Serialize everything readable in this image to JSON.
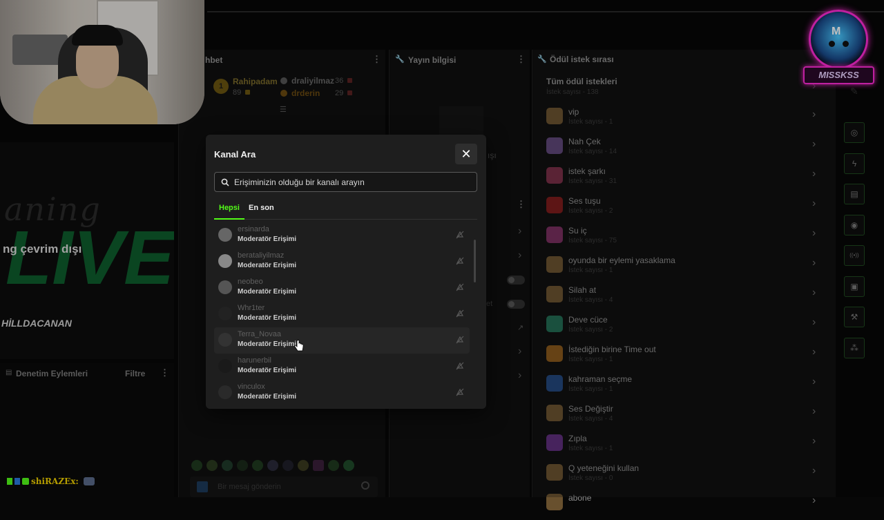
{
  "panels": {
    "chat_title_partial": "hbet",
    "stream_info_title": "Yayın bilgisi",
    "rewards_title": "Ödül istek sırası",
    "mod_actions_title": "Denetim Eylemleri",
    "mod_actions_filter": "Filtre"
  },
  "leaderboard": {
    "first": {
      "rank": "1",
      "name": "Rahipadam",
      "points": "89"
    },
    "second": {
      "name": "draliyilmaz",
      "points": "36"
    },
    "third": {
      "name": "drderin",
      "points": "29"
    }
  },
  "offline_banner": {
    "line1": "aning",
    "line2": "ng çevrim dışı",
    "sign": "HİLLDACANAN"
  },
  "stream_info_partial": "ışı",
  "chat": {
    "input_placeholder": "Bir mesaj gönderin",
    "user_overlay": "shiRAZEx:"
  },
  "modal": {
    "title": "Kanal Ara",
    "close_symbol": "✕",
    "search_placeholder": "Erişiminizin olduğu bir kanalı arayın",
    "tabs": [
      "Hepsi",
      "En son"
    ],
    "active_tab": "Hepsi",
    "channels": [
      {
        "name": "ersinarda",
        "role": "Moderatör Erişimi"
      },
      {
        "name": "berataliyilmaz",
        "role": "Moderatör Erişimi"
      },
      {
        "name": "neobeo",
        "role": "Moderatör Erişimi"
      },
      {
        "name": "Whr1ter",
        "role": "Moderatör Erişimi"
      },
      {
        "name": "Terra_Novaa",
        "role": "Moderatör Erişimi"
      },
      {
        "name": "harunerbil",
        "role": "Moderatör Erişimi"
      },
      {
        "name": "vinculox",
        "role": "Moderatör Erişimi"
      }
    ]
  },
  "rewards": {
    "all_title": "Tüm ödül istekleri",
    "all_count": "İstek sayısı - 138",
    "items": [
      {
        "title": "vip",
        "count": "İstek sayısı - 1",
        "color": "#8a6a3c"
      },
      {
        "title": "Nah Çek",
        "count": "İstek sayısı - 14",
        "color": "#7a5a9c"
      },
      {
        "title": "istek şarkı",
        "count": "İstek sayısı - 31",
        "color": "#9c3a5a"
      },
      {
        "title": "Ses tuşu",
        "count": "İstek sayısı - 2",
        "color": "#a02020"
      },
      {
        "title": "Su iç",
        "count": "İstek sayısı - 75",
        "color": "#9c3a7a"
      },
      {
        "title": "oyunda bir eylemi yasaklama",
        "count": "İstek sayısı - 1",
        "color": "#8a6a3c"
      },
      {
        "title": "Silah at",
        "count": "İstek sayısı - 4",
        "color": "#8a6a3c"
      },
      {
        "title": "Deve cüce",
        "count": "İstek sayısı - 2",
        "color": "#2a8a6a"
      },
      {
        "title": "İstediğin birine Time out",
        "count": "İstek sayısı - 1",
        "color": "#b07020"
      },
      {
        "title": "kahraman seçme",
        "count": "İstek sayısı - 1",
        "color": "#2a5aa0"
      },
      {
        "title": "Ses Değiştir",
        "count": "İstek sayısı - 4",
        "color": "#8a6a3c"
      },
      {
        "title": "Zıpla",
        "count": "İstek sayısı - 1",
        "color": "#7a3aa0"
      },
      {
        "title": "Q yeteneğini kullan",
        "count": "İstek sayısı - 0",
        "color": "#8a6a3c"
      },
      {
        "title": "abone",
        "count": "",
        "color": "#8a6a3c"
      }
    ]
  },
  "logo": {
    "text": "MISSKSS",
    "letter": "M"
  },
  "colors": {
    "accent": "#53fc18",
    "logo_pink": "#ff2bd6"
  },
  "toolbar_icons": [
    "camera-icon",
    "lightning-icon",
    "notes-icon",
    "chat-icon",
    "broadcast-icon",
    "video-icon",
    "wrench-icon",
    "users-icon"
  ]
}
